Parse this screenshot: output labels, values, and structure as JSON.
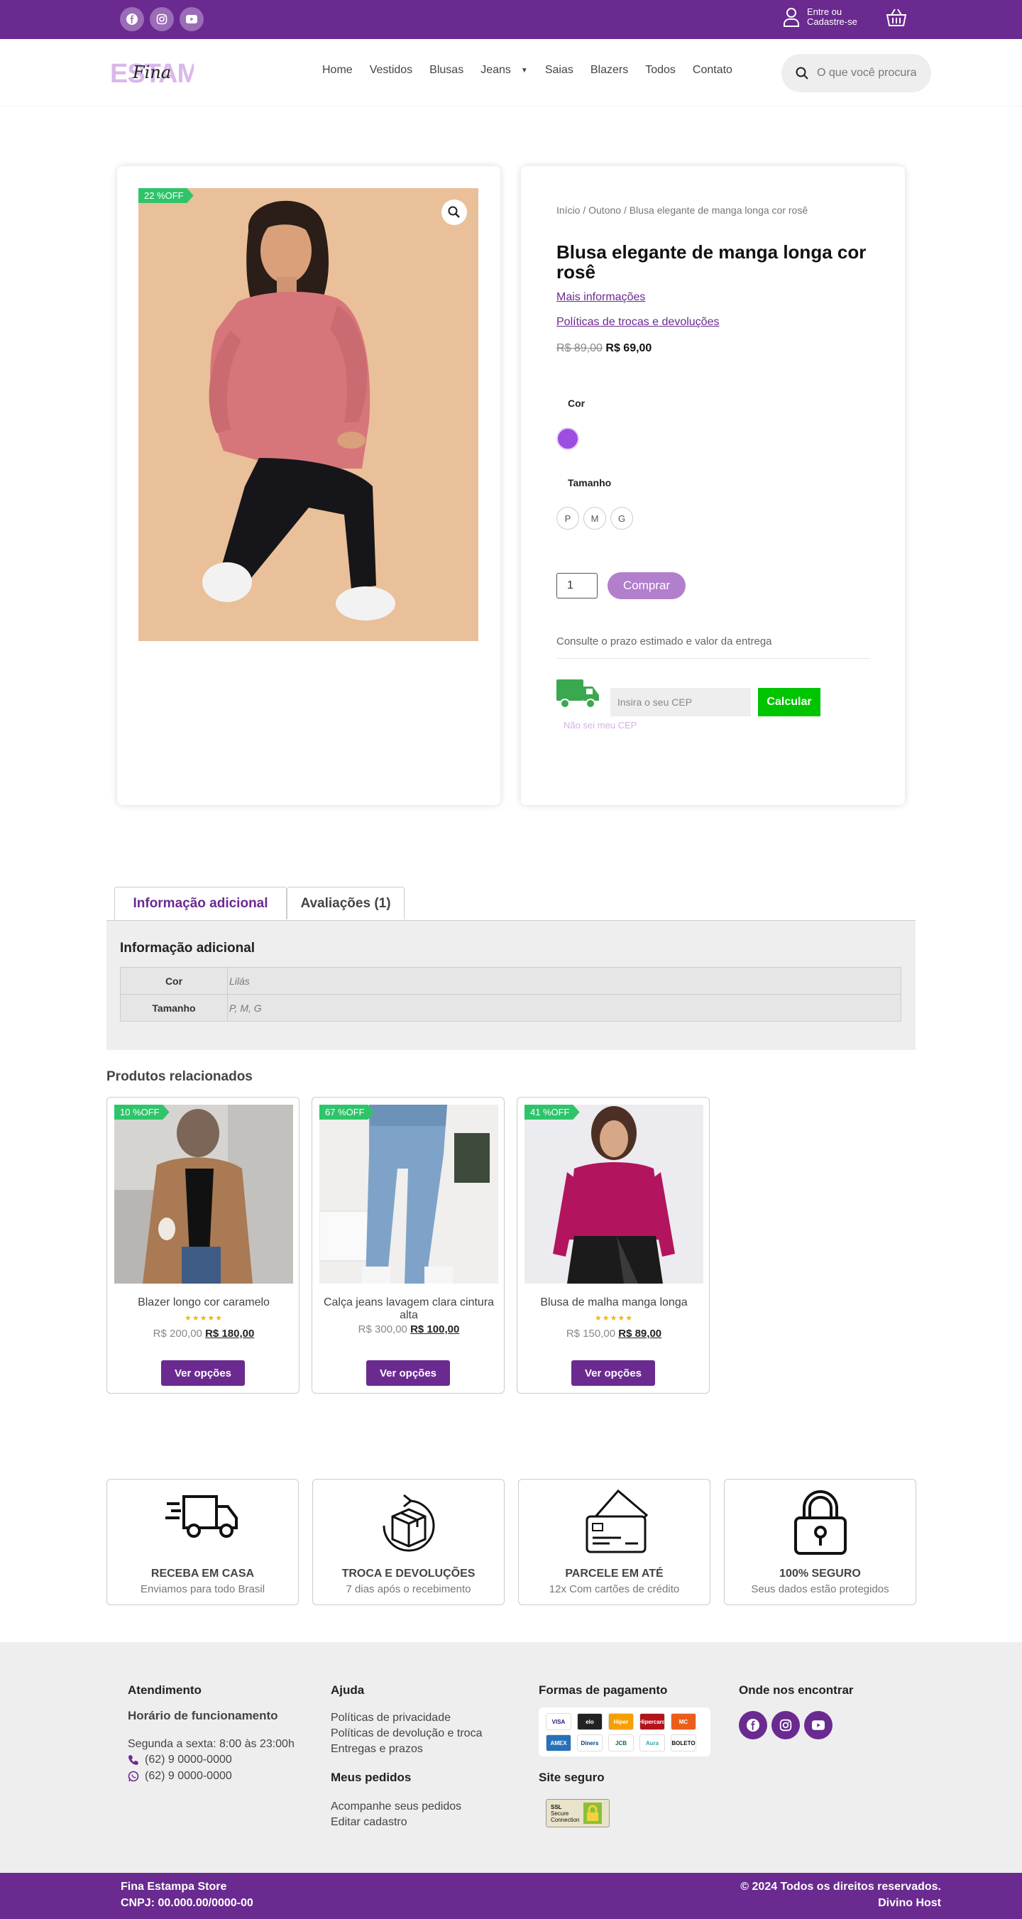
{
  "topbar": {
    "social": [
      "facebook-icon",
      "instagram-icon",
      "youtube-icon"
    ],
    "account_line1": "Entre ou",
    "account_line2": "Cadastre-se"
  },
  "header": {
    "logo_text": "ESTAMPA",
    "logo_script": "Fina",
    "nav": [
      "Home",
      "Vestidos",
      "Blusas",
      "Jeans",
      "Saias",
      "Blazers",
      "Todos",
      "Contato"
    ],
    "search_placeholder": "O que você procura?"
  },
  "product": {
    "discount_badge": "22 %OFF",
    "breadcrumb": "Início / Outono / Blusa elegante de manga longa cor rosê",
    "title": "Blusa elegante de manga longa cor rosê",
    "link_more": "Mais informações",
    "link_policies": "Políticas de trocas e devoluções",
    "old_price": "R$ 89,00",
    "new_price": "R$ 69,00",
    "color_label": "Cor",
    "size_label": "Tamanho",
    "sizes": [
      "P",
      "M",
      "G"
    ],
    "quantity": "1",
    "buy_label": "Comprar",
    "shipping_text": "Consulte o prazo estimado e valor da entrega",
    "cep_placeholder": "Insira o seu CEP",
    "calc_label": "Calcular",
    "no_cep": "Não sei meu CEP"
  },
  "tabs": {
    "tab1": "Informação adicional",
    "tab2": "Avaliações (1)",
    "panel_title": "Informação adicional",
    "rows": [
      {
        "key": "Cor",
        "value": "Lilás"
      },
      {
        "key": "Tamanho",
        "value": "P, M, G"
      }
    ]
  },
  "related": {
    "title": "Produtos relacionados",
    "items": [
      {
        "badge": "10 %OFF",
        "name": "Blazer longo cor caramelo",
        "stars": "★★★★★",
        "old": "R$ 200,00",
        "new": "R$ 180,00",
        "btn": "Ver opções"
      },
      {
        "badge": "67 %OFF",
        "name": "Calça jeans lavagem clara cintura alta",
        "stars": "",
        "old": "R$ 300,00",
        "new": "R$ 100,00",
        "btn": "Ver opções"
      },
      {
        "badge": "41 %OFF",
        "name": "Blusa de malha manga longa",
        "stars": "★★★★★",
        "old": "R$ 150,00",
        "new": "R$ 89,00",
        "btn": "Ver opções"
      }
    ]
  },
  "features": [
    {
      "icon": "delivery-truck-icon",
      "title": "RECEBA EM CASA",
      "sub": "Enviamos para todo Brasil"
    },
    {
      "icon": "box-return-icon",
      "title": "TROCA E DEVOLUÇÕES",
      "sub": "7 dias após o recebimento"
    },
    {
      "icon": "credit-card-icon",
      "title": "PARCELE EM ATÉ",
      "sub": "12x Com cartões de crédito"
    },
    {
      "icon": "padlock-icon",
      "title": "100% SEGURO",
      "sub": "Seus dados estão protegidos"
    }
  ],
  "footer": {
    "col1_title": "Atendimento",
    "col1_sub": "Horário de funcionamento",
    "hours": "Segunda a sexta: 8:00 às 23:00h",
    "phone": "(62) 9 0000-0000",
    "whatsapp": "(62) 9 0000-0000",
    "col2_title": "Ajuda",
    "help_links": [
      "Políticas de privacidade",
      "Políticas de devolução e troca",
      "Entregas e prazos"
    ],
    "orders_title": "Meus pedidos",
    "order_links": [
      "Acompanhe seus pedidos",
      "Editar cadastro"
    ],
    "col3_title": "Formas de pagamento",
    "payments": [
      "VISA",
      "elo",
      "Hiper",
      "Hipercard",
      "MC",
      "AMEX",
      "Diners",
      "JCB",
      "Aura",
      "BOLETO"
    ],
    "secure_title": "Site seguro",
    "ssl_lines": [
      "SSL",
      "Secure",
      "Connection"
    ],
    "col4_title": "Onde nos encontrar",
    "store_name": "Fina Estampa Store",
    "cnpj": "CNPJ: 00.000.00/0000-00",
    "copyright": "© 2024 Todos os direitos reservados.",
    "host": "Divino Host"
  },
  "colors": {
    "brand": "#6a2a90",
    "accent_green": "#2fc46a",
    "calc_green": "#00c400",
    "lilac": "#9d4ee0"
  }
}
